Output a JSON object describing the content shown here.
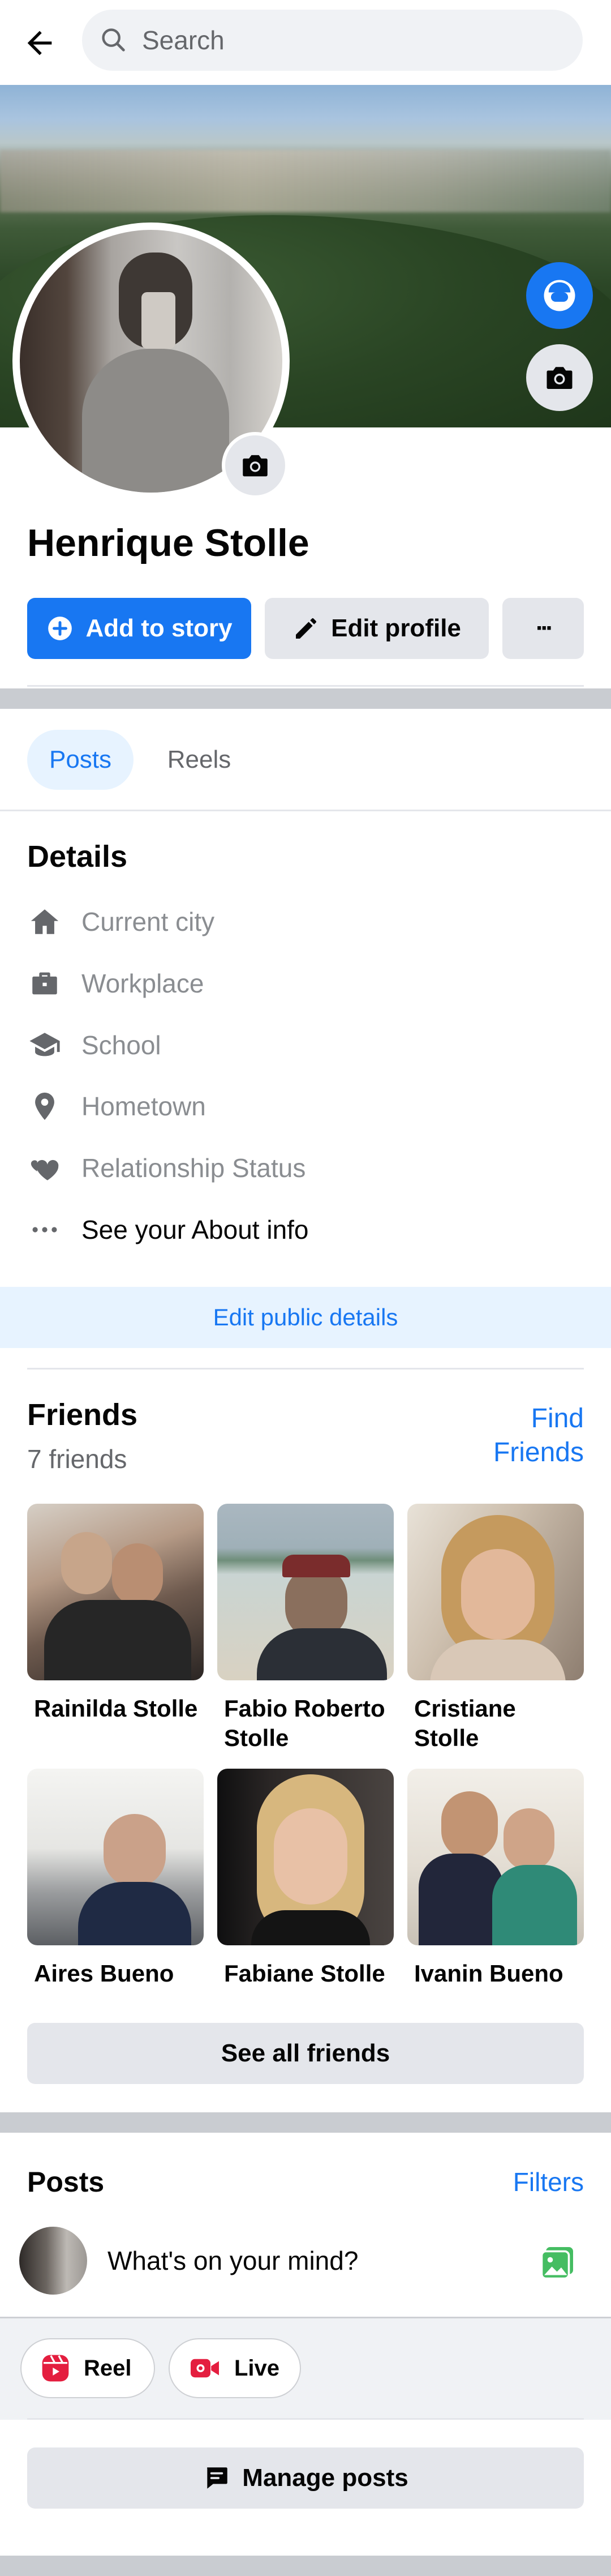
{
  "header": {
    "search_placeholder": "Search"
  },
  "profile": {
    "name": "Henrique Stolle"
  },
  "actions": {
    "add_story": "Add to story",
    "edit_profile": "Edit profile",
    "more": "···"
  },
  "tabs": [
    {
      "label": "Posts",
      "selected": true
    },
    {
      "label": "Reels",
      "selected": false
    }
  ],
  "details": {
    "title": "Details",
    "items": [
      {
        "icon": "house-icon",
        "label": "Current city"
      },
      {
        "icon": "briefcase-icon",
        "label": "Workplace"
      },
      {
        "icon": "graduation-cap-icon",
        "label": "School"
      },
      {
        "icon": "location-pin-icon",
        "label": "Hometown"
      },
      {
        "icon": "hearts-icon",
        "label": "Relationship Status"
      },
      {
        "icon": "ellipsis-icon",
        "label": "See your About info"
      }
    ],
    "edit_public": "Edit public details"
  },
  "friends": {
    "title": "Friends",
    "count": "7 friends",
    "find_line1": "Find",
    "find_line2": "Friends",
    "list": [
      {
        "name_line1": "Rainilda Stolle",
        "name_line2": ""
      },
      {
        "name_line1": "Fabio Roberto",
        "name_line2": "Stolle"
      },
      {
        "name_line1": "Cristiane",
        "name_line2": "Stolle"
      },
      {
        "name_line1": "Aires Bueno",
        "name_line2": ""
      },
      {
        "name_line1": "Fabiane Stolle",
        "name_line2": ""
      },
      {
        "name_line1": "Ivanin Bueno",
        "name_line2": ""
      }
    ],
    "see_all": "See all friends"
  },
  "posts": {
    "title": "Posts",
    "filters": "Filters",
    "composer_prompt": "What's on your mind?",
    "reel": "Reel",
    "live": "Live",
    "manage": "Manage posts"
  },
  "colors": {
    "accent": "#1877f2",
    "reel_red": "#e41e3f",
    "photo_green": "#45bd62"
  }
}
